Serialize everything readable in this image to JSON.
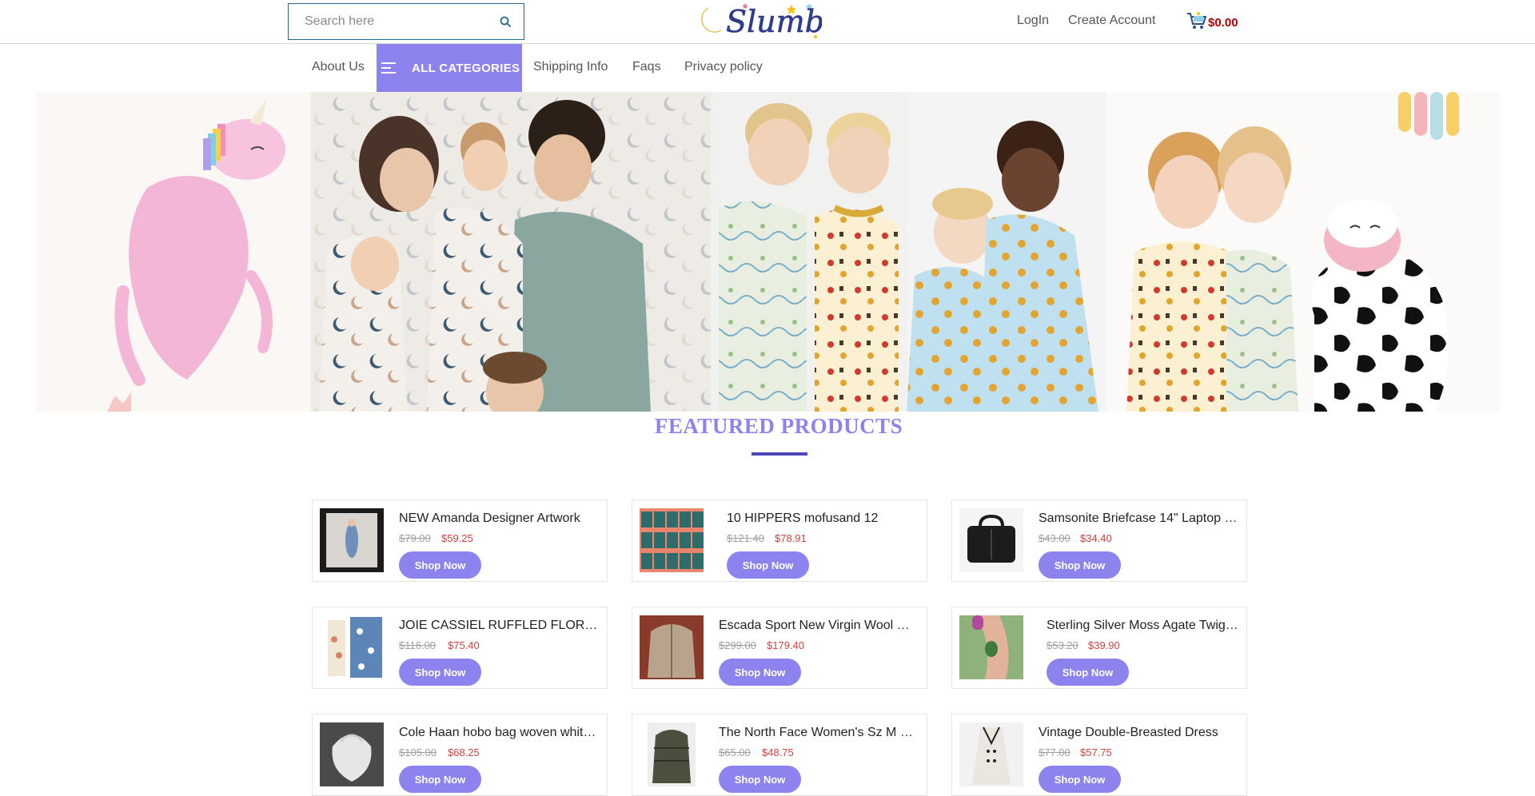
{
  "header": {
    "search_placeholder": "Search here",
    "logo_text": "Slumber",
    "login": "LogIn",
    "create_account": "Create Account",
    "cart_total": "$0.00"
  },
  "nav": {
    "about": "About Us",
    "all_categories": "ALL CATEGORIES",
    "shipping": "Shipping Info",
    "faqs": "Faqs",
    "privacy": "Privacy policy"
  },
  "featured": {
    "title": "FEATURED PRODUCTS"
  },
  "products": [
    {
      "name": "NEW Amanda Designer Artwork",
      "old_price": "$79.00",
      "price": "$59.25",
      "button": "Shop Now"
    },
    {
      "name": "10 HIPPERS mofusand 12",
      "old_price": "$121.40",
      "price": "$78.91",
      "button": "Shop Now"
    },
    {
      "name": "Samsonite Briefcase 14\" Laptop …",
      "old_price": "$43.00",
      "price": "$34.40",
      "button": "Shop Now"
    },
    {
      "name": "JOIE CASSIEL RUFFLED FLOR…",
      "old_price": "$116.00",
      "price": "$75.40",
      "button": "Shop Now"
    },
    {
      "name": "Escada Sport New Virgin Wool …",
      "old_price": "$299.00",
      "price": "$179.40",
      "button": "Shop Now"
    },
    {
      "name": "Sterling Silver Moss Agate Twig…",
      "old_price": "$53.20",
      "price": "$39.90",
      "button": "Shop Now"
    },
    {
      "name": "Cole Haan hobo bag woven whit…",
      "old_price": "$105.00",
      "price": "$68.25",
      "button": "Shop Now"
    },
    {
      "name": "The North Face Women's Sz M …",
      "old_price": "$65.00",
      "price": "$48.75",
      "button": "Shop Now"
    },
    {
      "name": "Vintage Double-Breasted Dress",
      "old_price": "$77.00",
      "price": "$57.75",
      "button": "Shop Now"
    }
  ],
  "colors": {
    "accent": "#8c83ee",
    "sale_price": "#d14343",
    "cart_price": "#b30000"
  }
}
